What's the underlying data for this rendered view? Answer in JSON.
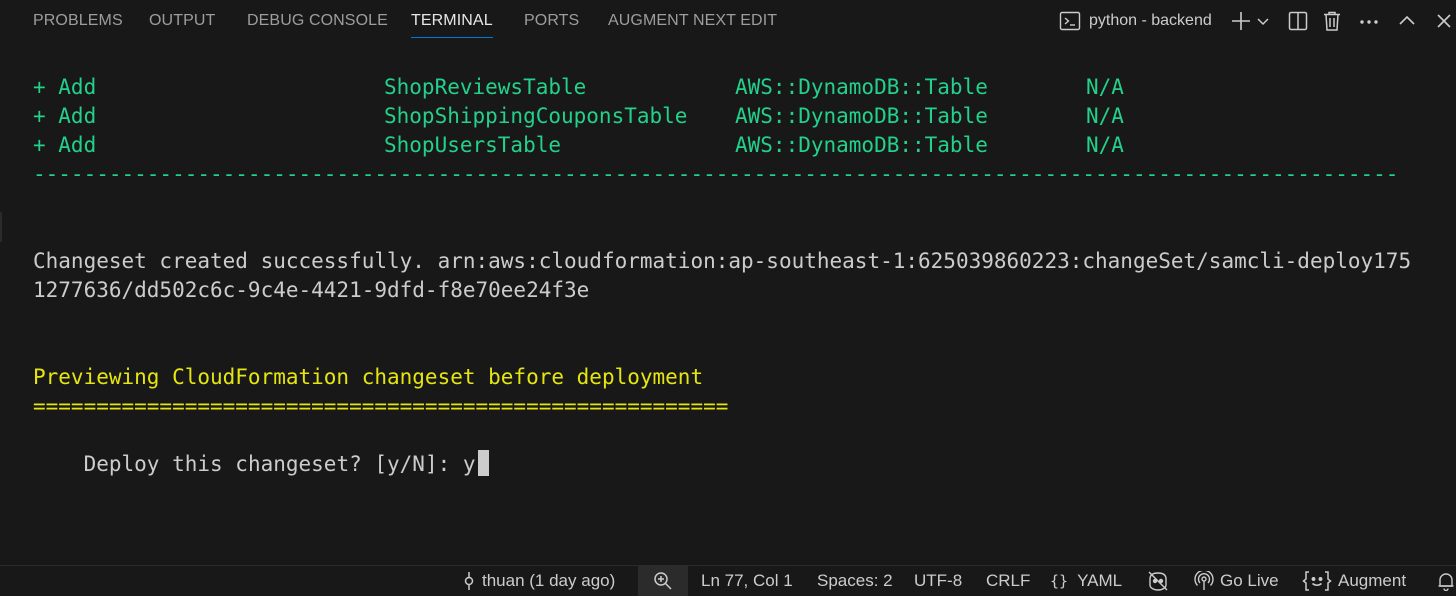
{
  "panel": {
    "tabs": [
      {
        "label": "PROBLEMS",
        "active": false
      },
      {
        "label": "OUTPUT",
        "active": false
      },
      {
        "label": "DEBUG CONSOLE",
        "active": false
      },
      {
        "label": "TERMINAL",
        "active": true
      },
      {
        "label": "PORTS",
        "active": false
      },
      {
        "label": "AUGMENT NEXT EDIT",
        "active": false
      }
    ],
    "terminal_name": "python - backend",
    "icons": [
      "terminal-icon",
      "new-terminal-icon",
      "chevron-down-icon",
      "split-terminal-icon",
      "trash-icon",
      "more-actions-icon",
      "maximize-panel-icon",
      "close-panel-icon"
    ],
    "accent_color": "#0078d4"
  },
  "terminal": {
    "rows": [
      {
        "operation": "+ Add",
        "logical_id": "ShopReviewsTable",
        "resource_type": "AWS::DynamoDB::Table",
        "replacement": "N/A"
      },
      {
        "operation": "+ Add",
        "logical_id": "ShopShippingCouponsTable",
        "resource_type": "AWS::DynamoDB::Table",
        "replacement": "N/A"
      },
      {
        "operation": "+ Add",
        "logical_id": "ShopUsersTable",
        "resource_type": "AWS::DynamoDB::Table",
        "replacement": "N/A"
      }
    ],
    "dash_line": "-----------------------------------------------------------------------------------------------------------------------------------------",
    "changeset_line1": "Changeset created successfully. arn:aws:cloudformation:ap-southeast-1:625039860223:changeSet/samcli-deploy175",
    "changeset_line2": "1277636/dd502c6c-9c4e-4421-9dfd-f8e70ee24f3e",
    "preview_title": "Previewing CloudFormation changeset before deployment",
    "equals_line": "=======================================================",
    "prompt": "Deploy this changeset? [y/N]: ",
    "input_value": "y",
    "colors": {
      "green": "#23d18b",
      "yellow": "#e5e510",
      "text": "#cccccc",
      "background": "#181818"
    }
  },
  "statusbar": {
    "git_blame": "thuan (1 day ago)",
    "cursor_position": "Ln 77, Col 1",
    "indentation": "Spaces: 2",
    "encoding": "UTF-8",
    "eol": "CRLF",
    "language": "YAML",
    "go_live": "Go Live",
    "augment": "Augment",
    "icons": [
      "git-commit-icon",
      "zoom-icon",
      "braces-icon",
      "copilot-disabled-icon",
      "broadcast-icon",
      "augment-icon",
      "notification-bell-icon"
    ]
  }
}
